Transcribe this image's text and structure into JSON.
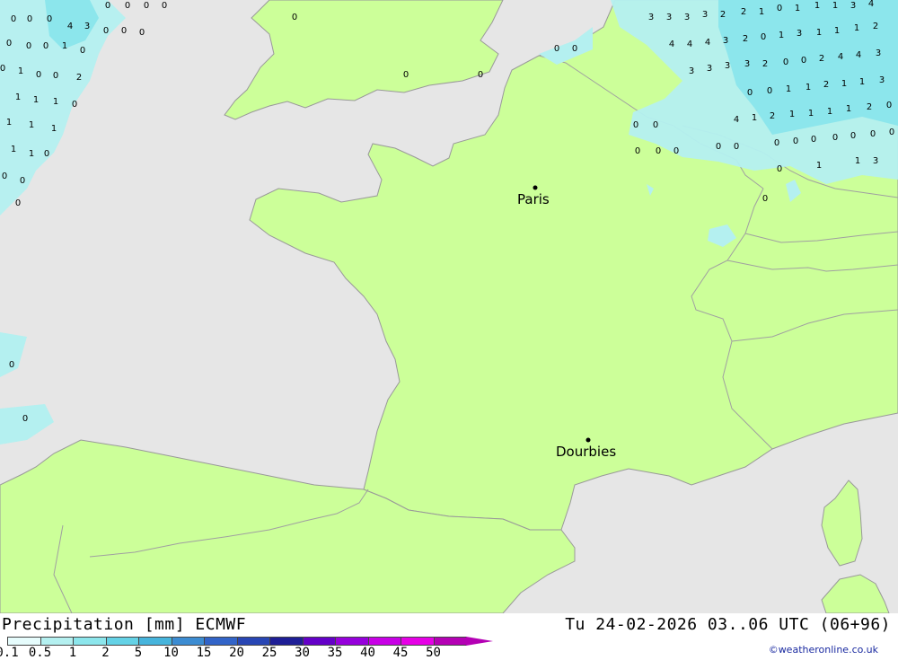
{
  "footer": {
    "title": "Precipitation [mm] ECMWF",
    "datetime": "Tu 24-02-2026 03..06 UTC (06+96)",
    "credit": "©weatheronline.co.uk"
  },
  "legend": {
    "labels": [
      "0.1",
      "0.5",
      "1",
      "2",
      "5",
      "10",
      "15",
      "20",
      "25",
      "30",
      "35",
      "40",
      "45",
      "50"
    ],
    "colors": [
      "#e6fcfc",
      "#b4f0f0",
      "#8ce6ec",
      "#64d2e6",
      "#46b4dc",
      "#3c8cd2",
      "#3264c8",
      "#2846b4",
      "#1e1e96",
      "#6400c8",
      "#9600dc",
      "#c800e6",
      "#e600e6",
      "#b400b4"
    ]
  },
  "map": {
    "colors": {
      "sea": "#e6e6e6",
      "land": "#ccff99",
      "border": "#a0a0a0",
      "coast": "#999999"
    },
    "cities": [
      {
        "name": "Paris"
      },
      {
        "name": "Dourbies"
      }
    ],
    "precip_values": [
      "0",
      "0",
      "0",
      "0",
      "0",
      "0",
      "0",
      "0",
      "4",
      "3",
      "0",
      "0",
      "0",
      "0",
      "0",
      "1",
      "0",
      "0",
      "1",
      "0",
      "0",
      "2",
      "1",
      "1",
      "1",
      "0",
      "1",
      "1",
      "1",
      "1",
      "1",
      "0",
      "0",
      "0",
      "0",
      "0",
      "0",
      "0",
      "0",
      "0",
      "0",
      "0",
      "0",
      "0",
      "0",
      "0",
      "0",
      "0",
      "1",
      "1",
      "3",
      "3",
      "3",
      "3",
      "3",
      "2",
      "2",
      "1",
      "0",
      "1",
      "1",
      "1",
      "3",
      "4",
      "4",
      "4",
      "4",
      "3",
      "2",
      "0",
      "1",
      "3",
      "1",
      "1",
      "1",
      "2",
      "3",
      "3",
      "3",
      "3",
      "2",
      "0",
      "0",
      "2",
      "4",
      "4",
      "3",
      "0",
      "0",
      "1",
      "1",
      "2",
      "1",
      "1",
      "3",
      "4",
      "1",
      "2",
      "1",
      "1",
      "1",
      "1",
      "2",
      "0",
      "0",
      "0",
      "0",
      "0",
      "0",
      "0",
      "0",
      "0",
      "0",
      "0"
    ]
  }
}
